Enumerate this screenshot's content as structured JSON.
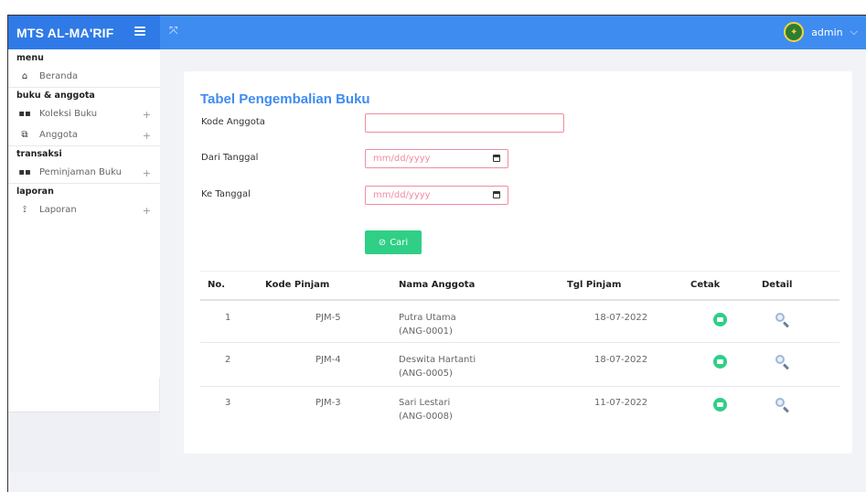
{
  "header": {
    "app_title": "MTS AL-MA'RIF",
    "user_name": "admin",
    "user_chevron": "⌵"
  },
  "sidebar": {
    "sections": [
      {
        "title": "menu",
        "items": [
          {
            "label": "Beranda",
            "icon": "home-icon",
            "expandable": false
          }
        ]
      },
      {
        "title": "buku & anggota",
        "items": [
          {
            "label": "Koleksi Buku",
            "icon": "grid-icon",
            "expandable": true
          },
          {
            "label": "Anggota",
            "icon": "users-icon",
            "expandable": true
          }
        ]
      },
      {
        "title": "transaksi",
        "items": [
          {
            "label": "Peminjaman Buku",
            "icon": "grid-icon",
            "expandable": true
          }
        ]
      },
      {
        "title": "laporan",
        "items": [
          {
            "label": "Laporan",
            "icon": "report-icon",
            "expandable": true
          }
        ]
      }
    ],
    "plus_glyph": "+"
  },
  "main": {
    "title": "Tabel Pengembalian Buku",
    "form": {
      "kode_anggota_label": "Kode Anggota",
      "kode_anggota_value": "",
      "dari_label": "Dari Tanggal",
      "dari_placeholder": "mm/dd/yyyy",
      "ke_label": "Ke Tanggal",
      "ke_placeholder": "mm/dd/yyyy",
      "search_button": "Cari"
    },
    "table": {
      "columns": [
        "No.",
        "Kode Pinjam",
        "Nama Anggota",
        "Tgl Pinjam",
        "Cetak",
        "Detail"
      ],
      "rows": [
        {
          "no": "1",
          "kode": "PJM-5",
          "nama": "Putra Utama",
          "id": "(ANG-0001)",
          "tgl": "18-07-2022"
        },
        {
          "no": "2",
          "kode": "PJM-4",
          "nama": "Deswita Hartanti",
          "id": "(ANG-0005)",
          "tgl": "18-07-2022"
        },
        {
          "no": "3",
          "kode": "PJM-3",
          "nama": "Sari Lestari",
          "id": "(ANG-0008)",
          "tgl": "11-07-2022"
        }
      ]
    }
  },
  "colors": {
    "topbar": "#3f8cf0",
    "accent_title": "#3f8cf0",
    "success": "#2fcf86",
    "input_border": "#f08ca0"
  }
}
